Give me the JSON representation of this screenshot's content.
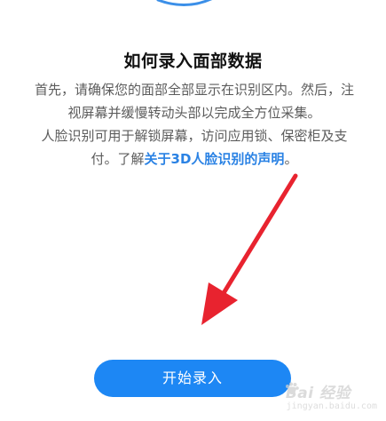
{
  "title": "如何录入面部数据",
  "paragraph1": "首先，请确保您的面部全部显示在识别区内。然后，注视屏幕并缓慢转动头部以完成全方位采集。",
  "paragraph2_text": "人脸识别可用于解锁屏幕，访问应用锁、保密柜及支付。了解",
  "paragraph2_link": "关于3D人脸识别的声明",
  "paragraph2_end": "。",
  "start_button_label": "开始录入",
  "watermark": {
    "logo_text": "Bai 经验",
    "url_text": "jingyan.baidu.com"
  },
  "colors": {
    "accent": "#1d87f4",
    "link": "#2a82e4",
    "annotation_arrow": "#e8232f"
  },
  "icons": {
    "top_fragment": "face-scan-graphic-fragment",
    "arrow": "red-annotation-arrow",
    "watermark_paw": "baidu-paw-icon"
  }
}
